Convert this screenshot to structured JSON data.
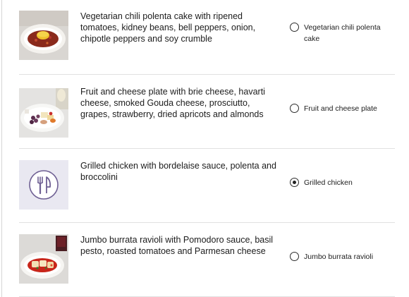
{
  "meals": [
    {
      "description": "Vegetarian chili polenta cake with ripened tomatoes, kidney beans, bell peppers, onion, chipotle peppers and soy crumble",
      "option_label": "Vegetarian chili polenta cake",
      "selected": false,
      "image": "chili-polenta-photo"
    },
    {
      "description": "Fruit and cheese plate with brie cheese, havarti cheese, smoked Gouda cheese, prosciutto, grapes, strawberry, dried apricots and almonds",
      "option_label": "Fruit and cheese plate",
      "selected": false,
      "image": "fruit-cheese-photo"
    },
    {
      "description": "Grilled chicken with bordelaise sauce, polenta and broccolini",
      "option_label": "Grilled chicken",
      "selected": true,
      "image": "fork-knife-icon"
    },
    {
      "description": "Jumbo burrata ravioli with Pomodoro sauce, basil pesto, roasted tomatoes and Parmesan cheese",
      "option_label": "Jumbo burrata ravioli",
      "selected": false,
      "image": "ravioli-photo"
    }
  ],
  "colors": {
    "placeholder_bg": "#e9e8f1",
    "placeholder_icon": "#6e5f93",
    "divider": "#e1e1e1"
  }
}
